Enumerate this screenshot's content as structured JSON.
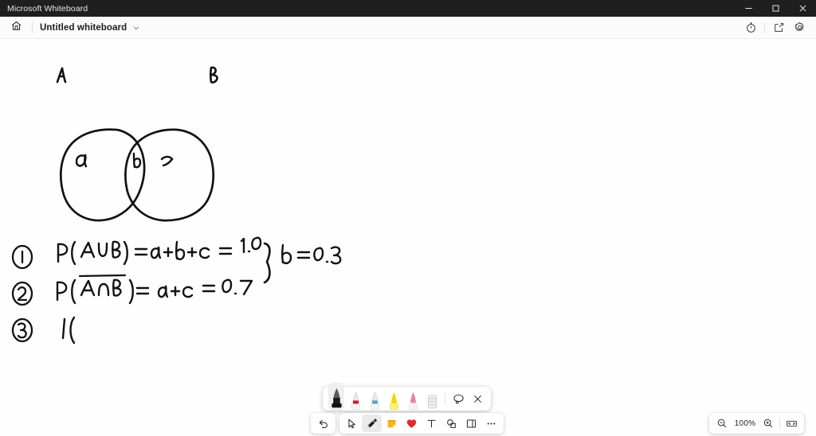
{
  "window": {
    "app_title": "Microsoft Whiteboard",
    "controls": [
      {
        "name": "minimize",
        "label": "Minimize"
      },
      {
        "name": "maximize",
        "label": "Maximize"
      },
      {
        "name": "close",
        "label": "Close"
      }
    ]
  },
  "header": {
    "home_icon": "home-icon",
    "document_title": "Untitled whiteboard",
    "title_chevron": "chevron-down-icon",
    "actions": [
      {
        "name": "timer-icon",
        "label": "Timer"
      },
      {
        "name": "share-icon",
        "label": "Share"
      },
      {
        "name": "settings-gear-icon",
        "label": "Settings"
      }
    ]
  },
  "canvas": {
    "background": "#fefefe",
    "ink_color": "#111111",
    "diagram": {
      "type": "venn-diagram",
      "set_labels": [
        "A",
        "B"
      ],
      "region_labels": [
        "a",
        "b",
        "c"
      ],
      "description": "Two overlapping hand-drawn circles labelled A (left) and B (right); region a is A-only, b is the intersection, c is B-only."
    },
    "equations": [
      {
        "number": "1",
        "text": "P(A∪B) = a+b+c = 1.0"
      },
      {
        "number": "2",
        "text": "P(A∩B) = a+c = 0.7",
        "overline": "A∩B"
      },
      {
        "number": "3",
        "text": "P("
      }
    ],
    "brace_result": "b = 0.3"
  },
  "pen_picker": {
    "pens": [
      {
        "name": "black-pen",
        "color": "#1a1a1a",
        "selected": true
      },
      {
        "name": "red-pen",
        "color": "#d01933",
        "selected": false
      },
      {
        "name": "blue-pen",
        "color": "#5aa8c0",
        "selected": false
      },
      {
        "name": "yellow-highlighter",
        "color": "#f2d800",
        "selected": false
      },
      {
        "name": "pink-highlighter",
        "color": "#e87fa8",
        "selected": false
      }
    ],
    "tools": [
      {
        "name": "ruler-eraser-tool",
        "label": "Ruler"
      },
      {
        "name": "lasso-select-tool",
        "label": "Lasso select"
      },
      {
        "name": "close-pen-picker",
        "label": "Close"
      }
    ]
  },
  "toolbar": {
    "undo_label": "Undo",
    "items": [
      {
        "name": "select-tool",
        "label": "Select",
        "active": false
      },
      {
        "name": "pen-tool",
        "label": "Inking",
        "active": true
      },
      {
        "name": "note-tool",
        "label": "Note",
        "active": false
      },
      {
        "name": "reaction-tool",
        "label": "Reaction",
        "active": false
      },
      {
        "name": "text-tool",
        "label": "Text",
        "active": false
      },
      {
        "name": "shapes-tool",
        "label": "Shapes",
        "active": false
      },
      {
        "name": "templates-tool",
        "label": "Templates",
        "active": false
      },
      {
        "name": "more-tool",
        "label": "More",
        "active": false
      }
    ]
  },
  "zoom_controls": {
    "zoom_out_label": "Zoom out",
    "level": "100%",
    "zoom_in_label": "Zoom in",
    "fit_label": "Fit to screen"
  }
}
